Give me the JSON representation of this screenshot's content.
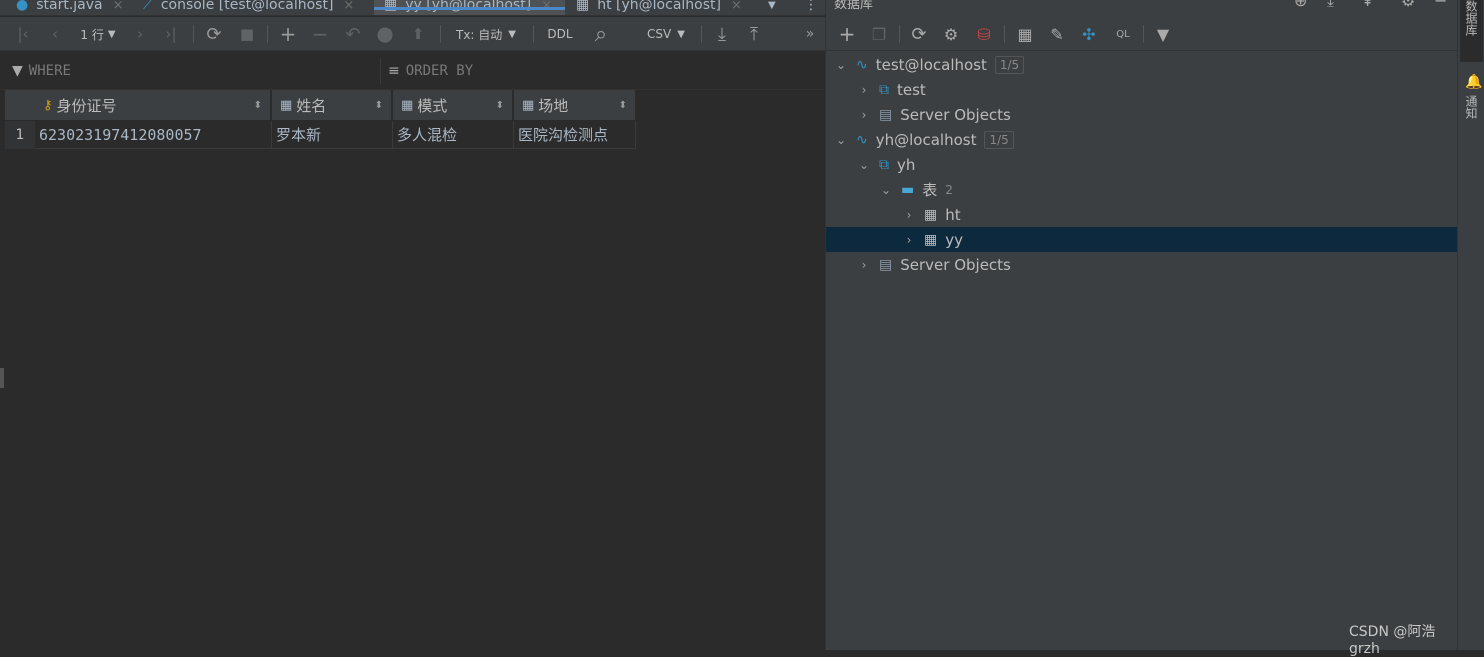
{
  "editor_tabs": [
    {
      "icon": "java-class-icon",
      "label": "start.java",
      "close": "×"
    },
    {
      "icon": "console-icon",
      "label": "console [test@localhost]",
      "close": "×"
    },
    {
      "icon": "table-icon",
      "label": "yy [yh@localhost]",
      "close": "×",
      "active": true
    },
    {
      "icon": "table-icon",
      "label": "ht [yh@localhost]",
      "close": "×"
    }
  ],
  "tabs_overflow": "⋮",
  "toolbar": {
    "first": "|‹",
    "prev": "‹",
    "rows_label": "1 行",
    "next": "›",
    "last": "›|",
    "refresh": "⟳",
    "stop": "■",
    "add": "+",
    "remove": "−",
    "revert": "↶",
    "submit": "⬤",
    "push": "⬆",
    "tx_label": "Tx: 自动",
    "ddl_label": "DDL",
    "search": "⌕",
    "csv_label": "CSV",
    "download": "⤓",
    "upload": "⤒",
    "more": "»"
  },
  "filter": {
    "where": "WHERE",
    "order_by": "ORDER BY"
  },
  "table": {
    "columns": [
      {
        "label": "身份证号",
        "icon": "primary-key-column-icon"
      },
      {
        "label": "姓名",
        "icon": "column-icon"
      },
      {
        "label": "模式",
        "icon": "column-icon"
      },
      {
        "label": "场地",
        "icon": "column-icon"
      }
    ],
    "rows": [
      {
        "num": "1",
        "cells": [
          "623023197412080057",
          "罗本新",
          "多人混检",
          "医院沟检测点"
        ]
      }
    ]
  },
  "db_panel": {
    "title": "数据库",
    "tree": [
      {
        "label": "test@localhost",
        "badge": "1/5",
        "icon": "mysql-datasource-icon",
        "expanded": true
      },
      {
        "label": "test",
        "icon": "schema-icon",
        "expanded": false
      },
      {
        "label": "Server Objects",
        "icon": "server-objects-icon",
        "expanded": false
      },
      {
        "label": "yh@localhost",
        "badge": "1/5",
        "icon": "mysql-datasource-icon",
        "expanded": true
      },
      {
        "label": "yh",
        "icon": "schema-icon",
        "expanded": true
      },
      {
        "label": "表",
        "count": "2",
        "icon": "folder-icon",
        "expanded": true
      },
      {
        "label": "ht",
        "icon": "table-icon",
        "expanded": false
      },
      {
        "label": "yy",
        "icon": "table-icon",
        "expanded": false,
        "selected": true
      },
      {
        "label": "Server Objects",
        "icon": "server-objects-icon",
        "expanded": false
      }
    ]
  },
  "side_strip": {
    "database_tab": "数据库",
    "notifications_tab": "通知"
  },
  "watermark": "CSDN @阿浩grzh"
}
